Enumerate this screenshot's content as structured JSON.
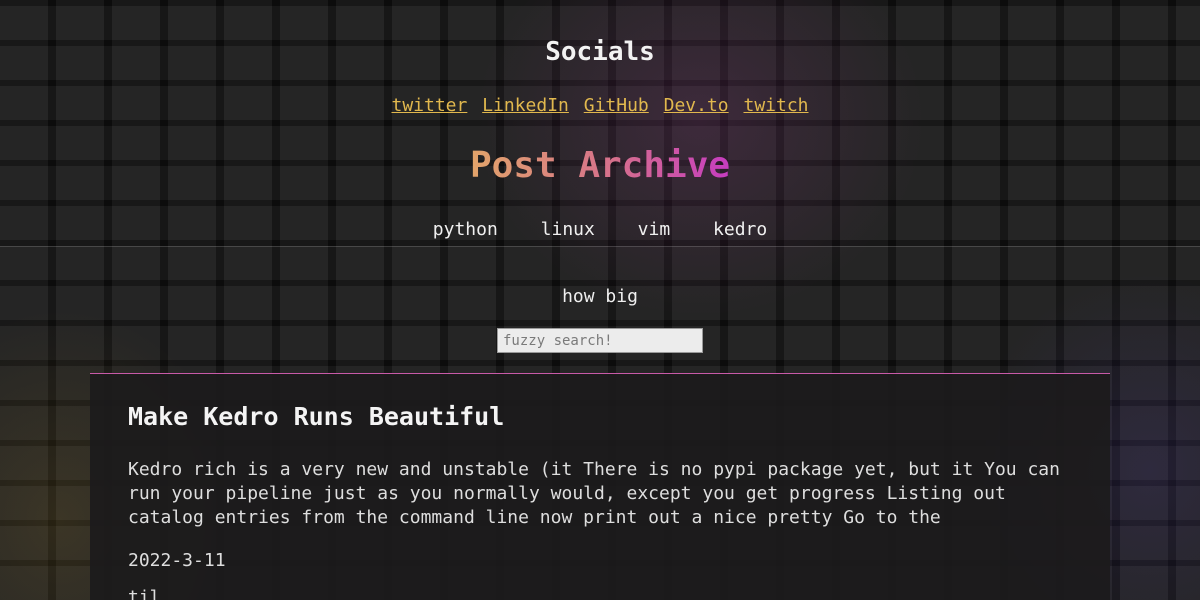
{
  "socials": {
    "title": "Socials",
    "links": [
      "twitter",
      "LinkedIn",
      "GitHub",
      "Dev.to",
      "twitch"
    ]
  },
  "archive": {
    "title": "Post Archive",
    "tags": [
      "python",
      "linux",
      "vim",
      "kedro"
    ]
  },
  "size_label": "how big",
  "search": {
    "placeholder": "fuzzy search!",
    "value": ""
  },
  "post": {
    "title": "Make Kedro Runs Beautiful",
    "excerpt": "Kedro rich is a very new and unstable (it There is no pypi package yet, but it You can run your pipeline just as you normally would, except you get progress Listing out catalog entries from the command line now print out a nice pretty Go to the",
    "date": "2022-3-11",
    "next_partial": "til"
  },
  "colors": {
    "link": "#e1b84e",
    "gradient_start": "#e2a56a",
    "gradient_end": "#c63cc0",
    "card_border": "#c85aa8"
  }
}
